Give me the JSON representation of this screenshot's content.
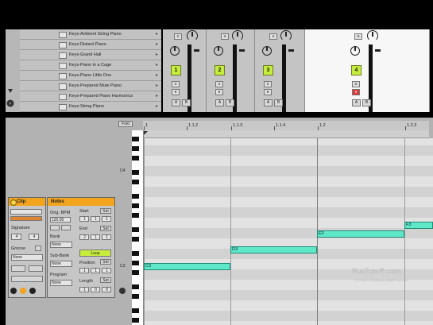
{
  "browser": {
    "items": [
      "Keys-Ambient String Piano",
      "Keys-Distant Piano",
      "Keys-Grand Hall",
      "Keys-Piano in a Cage",
      "Keys-Piano Little One",
      "Keys-Prepared Mute Piano",
      "Keys-Prepared Piano Harmonics",
      "Keys-String Piano"
    ]
  },
  "mixer": {
    "tracks": [
      {
        "number": "1",
        "solo": "S",
        "arm": "●",
        "a": "A",
        "b": "B"
      },
      {
        "number": "2",
        "solo": "S",
        "arm": "●",
        "a": "A",
        "b": "B"
      },
      {
        "number": "3",
        "solo": "S",
        "arm": "●",
        "a": "A",
        "b": "B"
      },
      {
        "number": "4",
        "solo": "S",
        "arm": "●",
        "a": "A",
        "b": "B"
      }
    ]
  },
  "clip_box": {
    "title": "Clip",
    "signature_label": "Signature",
    "sig_num": "4",
    "sig_den": "4",
    "groove_label": "Groove",
    "groove_value": "None"
  },
  "notes_box": {
    "title": "Notes",
    "orig_bpm_label": "Orig. BPM",
    "orig_bpm_value": "120.00",
    "bank_label": "Bank",
    "bank_value": "None",
    "subbank_label": "Sub-Bank",
    "subbank_value": "None",
    "program_label": "Program",
    "program_value": "None",
    "start_label": "Start",
    "start_set": "Set",
    "start_vals": [
      "1",
      "1",
      "1"
    ],
    "end_label": "End",
    "end_set": "Set",
    "end_vals": [
      "2",
      "1",
      "1"
    ],
    "loop_label": "Loop",
    "position_label": "Position",
    "position_set": "Set",
    "position_vals": [
      "1",
      "1",
      "1"
    ],
    "length_label": "Length",
    "length_set": "Set",
    "length_vals": [
      "1",
      "0",
      "0"
    ]
  },
  "editor": {
    "fold_label": "Fold",
    "ruler": [
      "1",
      "1.1.2",
      "1.1.3",
      "1.1.4",
      "1.2",
      "1.2.3"
    ],
    "octaves": [
      "C4",
      "C3"
    ],
    "notes": [
      {
        "pitch": "C3",
        "label": "C3"
      },
      {
        "pitch": "D3",
        "label": "D3"
      },
      {
        "pitch": "E3",
        "label": "E3"
      },
      {
        "pitch": "F3",
        "label": "F3"
      }
    ]
  },
  "watermark": {
    "brand": "RusTuts",
    "domain": ".com",
    "tagline": "Русские переводы видео уроков"
  },
  "colors": {
    "accent": "#f2a41f",
    "track_green": "#c6ec3c",
    "note": "#5fe8c8"
  }
}
